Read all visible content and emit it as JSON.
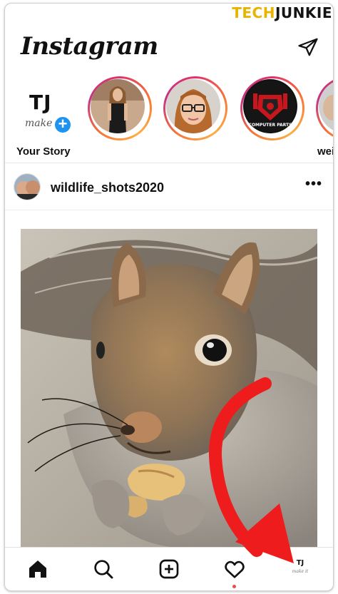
{
  "watermark": {
    "part1": "TECH",
    "part2": "JUNKIE"
  },
  "header": {
    "logo": "Instagram",
    "send_icon": "paper-plane-icon"
  },
  "stories": {
    "own": {
      "initials": "TJ",
      "sub": "make",
      "plus": "+",
      "label": "Your Story"
    },
    "items": [
      {
        "label": ""
      },
      {
        "label": ""
      },
      {
        "label": "",
        "badge": "COMPUTER PARTS"
      },
      {
        "label": "weir"
      }
    ]
  },
  "post": {
    "username": "wildlife_shots2020",
    "more": "•••"
  },
  "nav": {
    "items": [
      "home-icon",
      "search-icon",
      "add-post-icon",
      "activity-heart-icon",
      "profile-avatar"
    ],
    "profile_initials": "TJ",
    "profile_sub": "make it"
  },
  "colors": {
    "accent_blue": "#1e94f0",
    "arrow_red": "#ee1c1c",
    "notification_dot": "#ed4956",
    "watermark_yellow": "#e8b400"
  }
}
